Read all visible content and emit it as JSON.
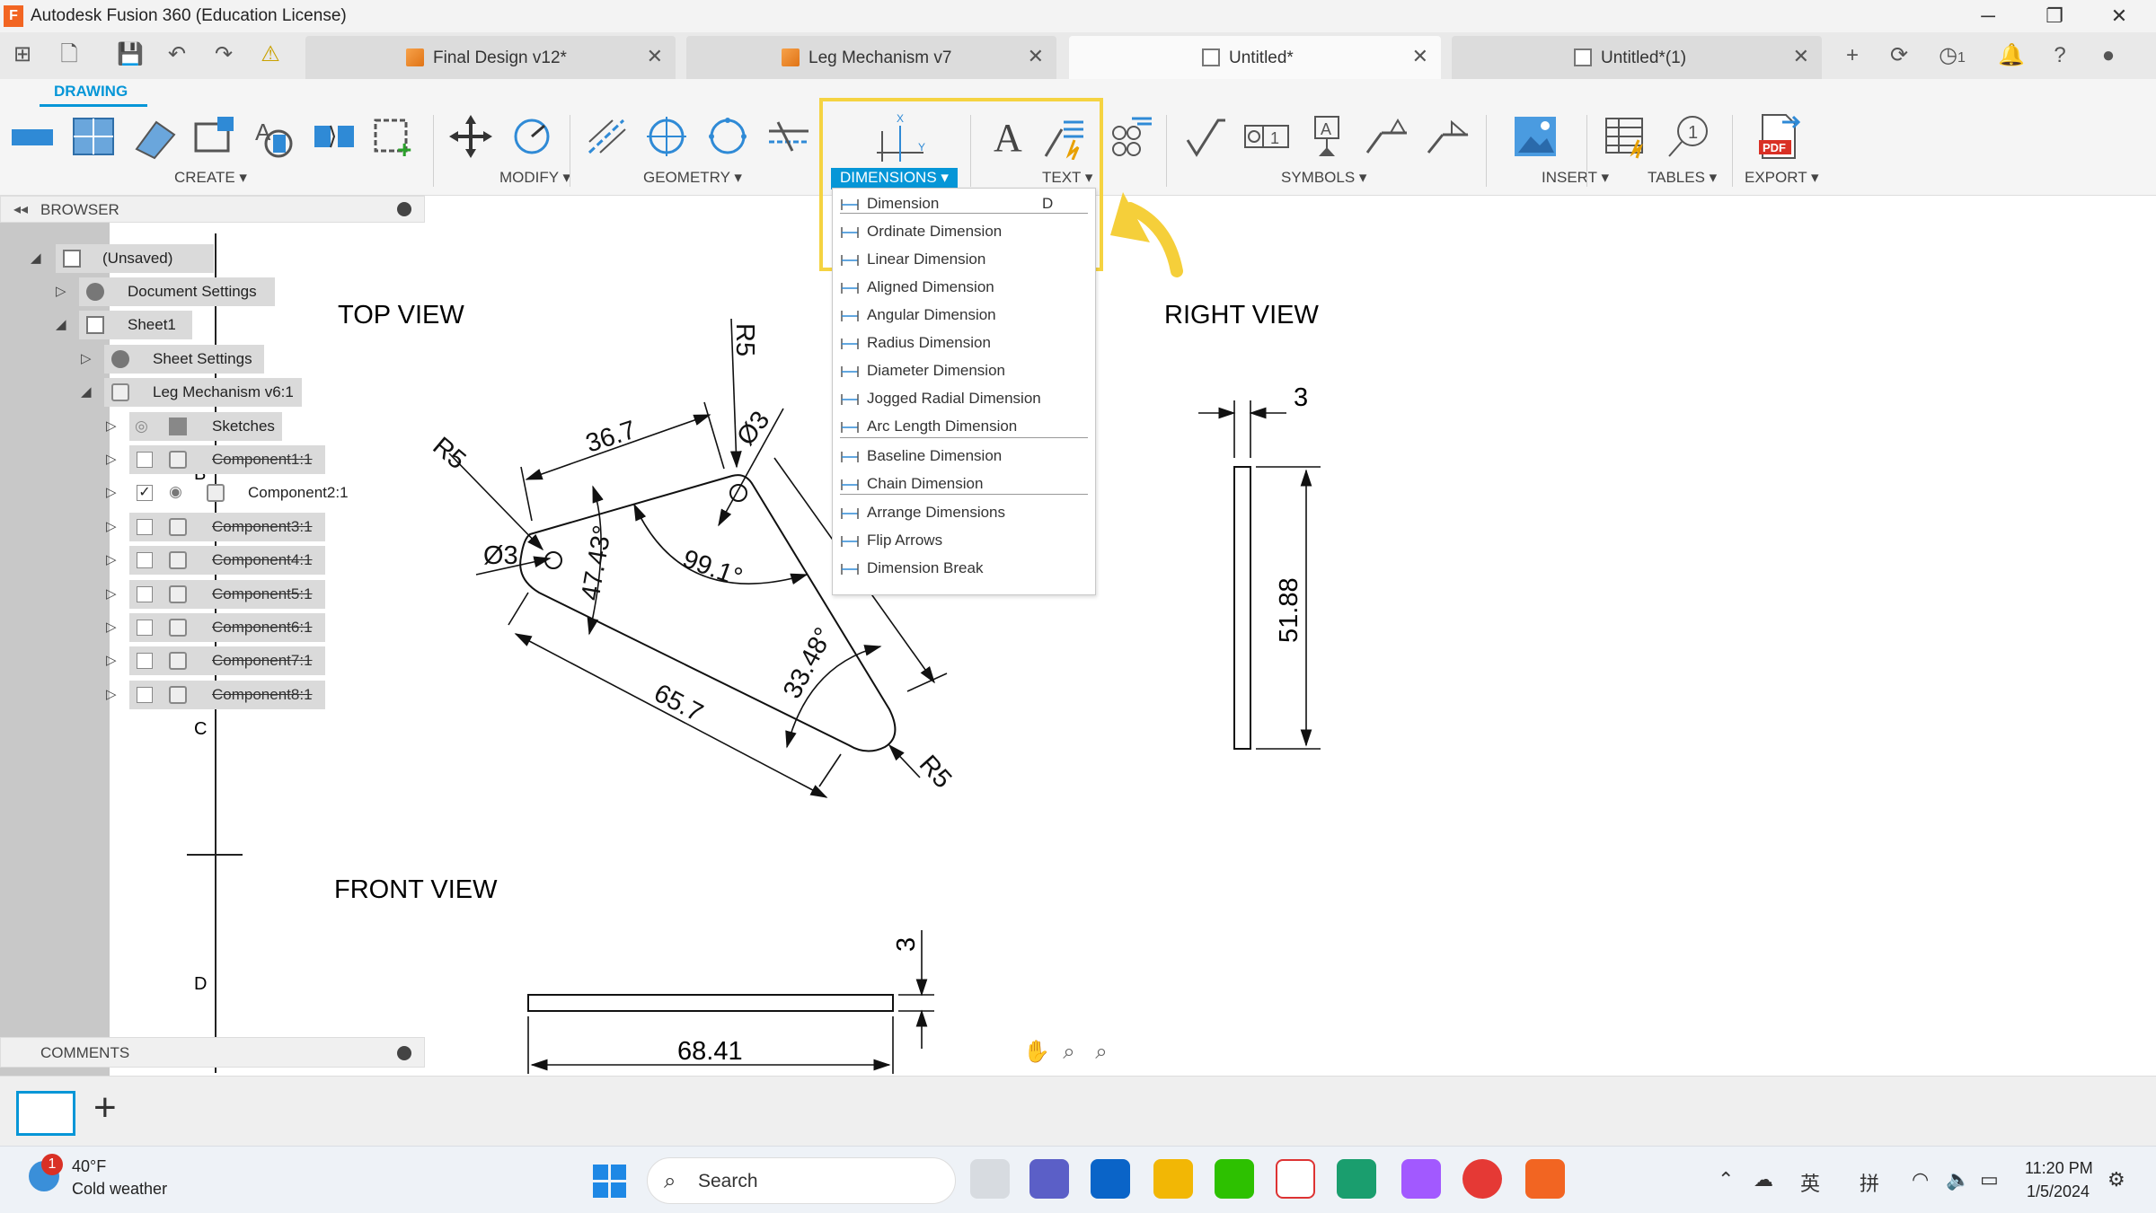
{
  "window": {
    "title": "Autodesk Fusion 360 (Education License)"
  },
  "tabs": [
    {
      "label": "Final Design v12*",
      "active": false
    },
    {
      "label": "Leg Mechanism v7",
      "active": false
    },
    {
      "label": "Untitled*",
      "active": true
    },
    {
      "label": "Untitled*(1)",
      "active": false
    }
  ],
  "jobs_count": "1",
  "ribbon": {
    "workspace_tab": "DRAWING",
    "groups": {
      "create": "CREATE ▾",
      "modify": "MODIFY ▾",
      "geometry": "GEOMETRY ▾",
      "dimensions": "DIMENSIONS ▾",
      "text": "TEXT ▾",
      "symbols": "SYMBOLS ▾",
      "insert": "INSERT ▾",
      "tables": "TABLES ▾",
      "export": "EXPORT ▾"
    },
    "export_badge": "PDF"
  },
  "dimensions_menu": {
    "items": [
      {
        "label": "Dimension",
        "shortcut": "D"
      },
      {
        "label": "Ordinate Dimension"
      },
      {
        "label": "Linear Dimension"
      },
      {
        "label": "Aligned Dimension"
      },
      {
        "label": "Angular Dimension"
      },
      {
        "label": "Radius Dimension"
      },
      {
        "label": "Diameter Dimension"
      },
      {
        "label": "Jogged Radial Dimension"
      },
      {
        "label": "Arc Length Dimension"
      },
      {
        "label": "Baseline Dimension"
      },
      {
        "label": "Chain Dimension"
      },
      {
        "label": "Arrange Dimensions"
      },
      {
        "label": "Flip Arrows"
      },
      {
        "label": "Dimension Break"
      }
    ]
  },
  "browser": {
    "title": "BROWSER",
    "root": "(Unsaved)",
    "document_settings": "Document Settings",
    "sheet": "Sheet1",
    "sheet_settings": "Sheet Settings",
    "view_ref": "Leg Mechanism v6:1",
    "sketches": "Sketches",
    "components": [
      {
        "label": "Component1:1",
        "checked": false
      },
      {
        "label": "Component2:1",
        "checked": true
      },
      {
        "label": "Component3:1",
        "checked": false
      },
      {
        "label": "Component4:1",
        "checked": false
      },
      {
        "label": "Component5:1",
        "checked": false
      },
      {
        "label": "Component6:1",
        "checked": false
      },
      {
        "label": "Component7:1",
        "checked": false
      },
      {
        "label": "Component8:1",
        "checked": false
      }
    ]
  },
  "comments": {
    "title": "COMMENTS"
  },
  "drawing": {
    "views": {
      "top": "TOP VIEW",
      "right": "RIGHT VIEW",
      "front": "FRONT VIEW"
    },
    "zone_labels": {
      "b": "B",
      "c": "C",
      "d": "D"
    },
    "dims": {
      "r5_left": "R5",
      "r5_top": "R5",
      "r5_bottom": "R5",
      "d3_left": "Ø3",
      "d3_top": "Ø3",
      "len_36": "36.7",
      "ang_47": "47.43°",
      "ang_99": "99.1°",
      "ang_33": "33.48°",
      "len_65": "65.7",
      "right_thk": "3",
      "right_h": "51.88",
      "front_thk": "3",
      "front_len": "68.41"
    }
  },
  "taskbar": {
    "weather_temp": "40°F",
    "weather_desc": "Cold weather",
    "weather_badge": "1",
    "search": "Search",
    "ime_1": "英",
    "ime_2": "拼",
    "time": "11:20 PM",
    "date": "1/5/2024"
  },
  "colors": {
    "accent": "#0696d7",
    "highlight": "#f5d341",
    "arrow": "#f5cf3a"
  }
}
